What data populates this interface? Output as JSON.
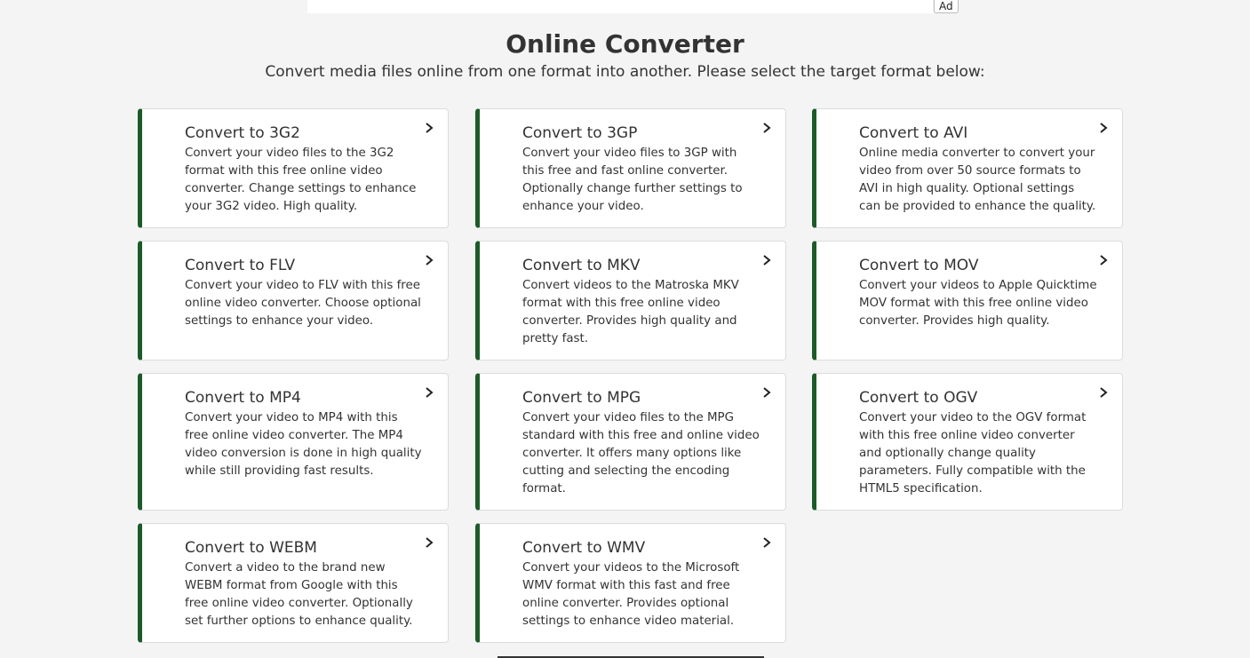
{
  "ad": {
    "label": "Ad"
  },
  "header": {
    "title": "Online Converter",
    "subtitle": "Convert media files online from one format into another. Please select the target format below:"
  },
  "converters": [
    {
      "title": "Convert to 3G2",
      "description": "Convert your video files to the 3G2 format with this free online video converter. Change settings to enhance your 3G2 video. High quality."
    },
    {
      "title": "Convert to 3GP",
      "description": "Convert your video files to 3GP with this free and fast online converter. Optionally change further settings to enhance your video."
    },
    {
      "title": "Convert to AVI",
      "description": "Online media converter to convert your video from over 50 source formats to AVI in high quality. Optional settings can be provided to enhance the quality."
    },
    {
      "title": "Convert to FLV",
      "description": "Convert your video to FLV with this free online video converter. Choose optional settings to enhance your video."
    },
    {
      "title": "Convert to MKV",
      "description": "Convert videos to the Matroska MKV format with this free online video converter. Provides high quality and pretty fast."
    },
    {
      "title": "Convert to MOV",
      "description": "Convert your videos to Apple Quicktime MOV format with this free online video converter. Provides high quality."
    },
    {
      "title": "Convert to MP4",
      "description": "Convert your video to MP4 with this free online video converter. The MP4 video conversion is done in high quality while still providing fast results."
    },
    {
      "title": "Convert to MPG",
      "description": "Convert your video files to the MPG standard with this free and online video converter. It offers many options like cutting and selecting the encoding format."
    },
    {
      "title": "Convert to OGV",
      "description": "Convert your video to the OGV format with this free online video converter and optionally change quality parameters. Fully compatible with the HTML5 specification."
    },
    {
      "title": "Convert to WEBM",
      "description": "Convert a video to the brand new WEBM format from Google with this free online video converter. Optionally set further options to enhance quality."
    },
    {
      "title": "Convert to WMV",
      "description": "Convert your videos to the Microsoft WMV format with this fast and free online converter. Provides optional settings to enhance video material."
    }
  ],
  "icons": {
    "card_arrow": "chevron-right-icon"
  },
  "colors": {
    "accent": "#1c5b28",
    "background": "#f4f4f4",
    "card": "#ffffff",
    "text": "#333333"
  }
}
